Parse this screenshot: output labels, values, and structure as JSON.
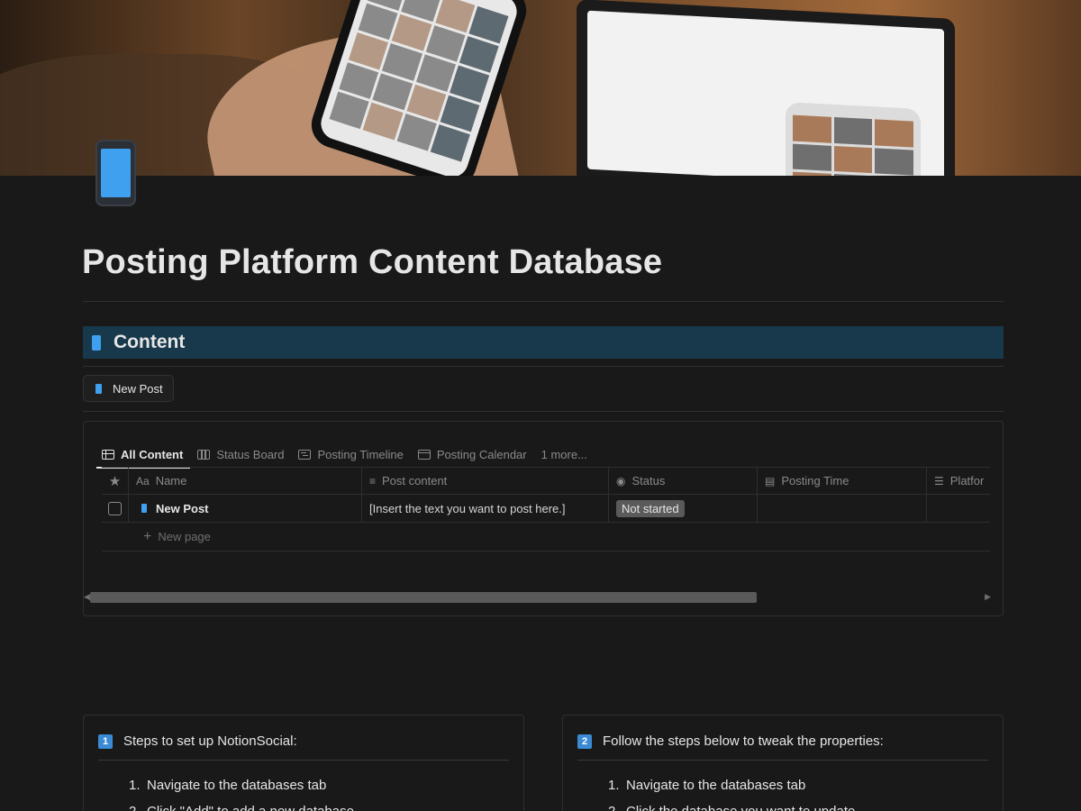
{
  "page": {
    "title": "Posting Platform Content Database"
  },
  "content_section": {
    "heading": "Content",
    "new_post_button": "New Post"
  },
  "database": {
    "tabs": [
      {
        "label": "All Content",
        "icon": "table-icon",
        "active": true
      },
      {
        "label": "Status Board",
        "icon": "board-icon",
        "active": false
      },
      {
        "label": "Posting Timeline",
        "icon": "timeline-icon",
        "active": false
      },
      {
        "label": "Posting Calendar",
        "icon": "calendar-icon",
        "active": false
      }
    ],
    "more_tabs": "1 more...",
    "columns": [
      {
        "label": "Name",
        "icon_text": "Aa"
      },
      {
        "label": "Post content",
        "icon_text": "≡"
      },
      {
        "label": "Status",
        "icon_text": "◉"
      },
      {
        "label": "Posting Time",
        "icon_text": "▤"
      },
      {
        "label": "Platfor",
        "icon_text": "☰"
      }
    ],
    "rows": [
      {
        "name": "New Post",
        "post_content": "[Insert the text you want to post here.]",
        "status": "Not started",
        "posting_time": "",
        "platform": ""
      }
    ],
    "new_page_label": "New page"
  },
  "callouts": [
    {
      "number": "1",
      "title": "Steps to set up NotionSocial:",
      "steps": [
        "Navigate to the databases tab",
        "Click \"Add\" to add a new database"
      ]
    },
    {
      "number": "2",
      "title": "Follow the steps below to tweak the properties:",
      "steps": [
        "Navigate to the databases tab",
        "Click the database you want to update"
      ]
    }
  ],
  "colors": {
    "background": "#191919",
    "header_band": "#18384b",
    "accent_blue": "#3fa0f0",
    "badge_gray": "#5a5a5a"
  }
}
